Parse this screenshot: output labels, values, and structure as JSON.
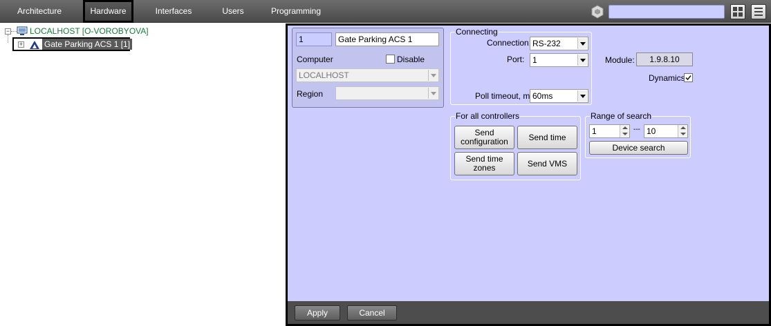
{
  "tabs": [
    {
      "label": "Architecture"
    },
    {
      "label": "Hardware"
    },
    {
      "label": "Interfaces"
    },
    {
      "label": "Users"
    },
    {
      "label": "Programming"
    }
  ],
  "search": {
    "value": ""
  },
  "tree": {
    "root_label": "LOCALHOST [O-VOROBYOVA]",
    "child_label": "Gate Parking ACS 1 [1]"
  },
  "object": {
    "id": "1",
    "name": "Gate Parking ACS 1",
    "computer_label": "Computer",
    "disable_label": "Disable",
    "computer_value": "LOCALHOST",
    "region_label": "Region",
    "region_value": ""
  },
  "connecting": {
    "title": "Connecting",
    "connection_label": "Connection:",
    "connection_value": "RS-232",
    "port_label": "Port:",
    "port_value": "1",
    "poll_label": "Poll timeout, ms:",
    "poll_value": "60ms"
  },
  "module": {
    "label": "Module:",
    "value": "1.9.8.10",
    "dynamics_label": "Dynamics",
    "dynamics_checked": true
  },
  "controllers": {
    "title": "For all controllers",
    "send_config": "Send configuration",
    "send_time": "Send time",
    "send_time_zones": "Send time zones",
    "send_vms": "Send VMS"
  },
  "range": {
    "title": "Range of search",
    "from": "1",
    "separator": "---",
    "to": "10",
    "device_search": "Device search"
  },
  "footer": {
    "apply": "Apply",
    "cancel": "Cancel"
  },
  "colors": {
    "panel_bg": "#ccccff",
    "topbar_bg": "#5a5a5a",
    "tree_root_text": "#1a7a3a",
    "selected_bg": "#5a5a5a"
  }
}
